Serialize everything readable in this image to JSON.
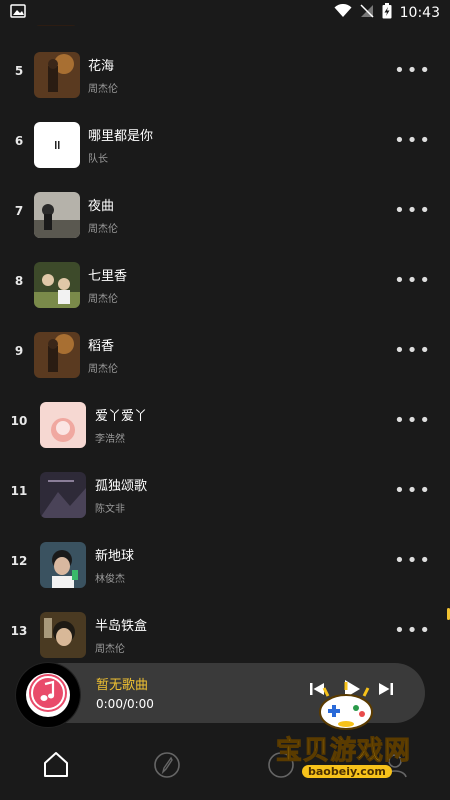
{
  "status_bar": {
    "time": "10:43",
    "icons": [
      "image-icon",
      "wifi-icon",
      "no-signal-icon",
      "battery-charging-icon"
    ]
  },
  "songs": [
    {
      "num": "5",
      "title": "花海",
      "artist": "周杰伦",
      "cover": "#8a5a2e"
    },
    {
      "num": "6",
      "title": "哪里都是你",
      "artist": "队长",
      "cover": "#ffffff"
    },
    {
      "num": "7",
      "title": "夜曲",
      "artist": "周杰伦",
      "cover": "#a8a6a0"
    },
    {
      "num": "8",
      "title": "七里香",
      "artist": "周杰伦",
      "cover": "#6a7a4a"
    },
    {
      "num": "9",
      "title": "稻香",
      "artist": "周杰伦",
      "cover": "#8a5a2e"
    },
    {
      "num": "10",
      "title": "爱丫爱丫",
      "artist": "李浩然",
      "cover": "#f2c7c1"
    },
    {
      "num": "11",
      "title": "孤独颂歌",
      "artist": "陈文非",
      "cover": "#3a3444"
    },
    {
      "num": "12",
      "title": "新地球",
      "artist": "林俊杰",
      "cover": "#4a6a7a"
    },
    {
      "num": "13",
      "title": "半岛铁盒",
      "artist": "周杰伦",
      "cover": "#6a5a3a"
    }
  ],
  "more_label": "•••",
  "player": {
    "song": "暂无歌曲",
    "time": "0:00/0:00",
    "accent": "#f1c232"
  },
  "watermark": {
    "text": "宝贝游戏网",
    "url": "baobeiy.com"
  },
  "nav": [
    "home-icon",
    "discover-icon",
    "circle-icon",
    "profile-icon"
  ]
}
